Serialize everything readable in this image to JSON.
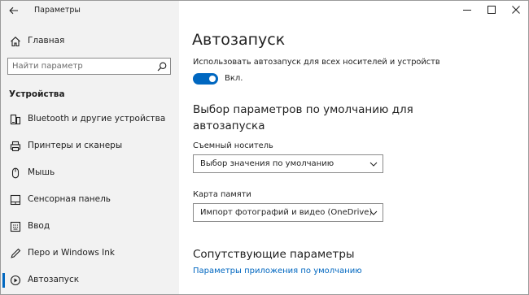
{
  "window": {
    "title": "Параметры",
    "controls": {
      "minimize_icon": "minimize-icon",
      "maximize_icon": "maximize-icon",
      "close_icon": "close-icon"
    }
  },
  "sidebar": {
    "back_icon": "back-arrow-icon",
    "home": {
      "label": "Главная",
      "icon": "home-icon"
    },
    "search": {
      "placeholder": "Найти параметр",
      "value": "",
      "icon": "search-icon"
    },
    "section_title": "Устройства",
    "items": [
      {
        "label": "Bluetooth и другие устройства",
        "icon": "bluetooth-devices-icon",
        "selected": false
      },
      {
        "label": "Принтеры и сканеры",
        "icon": "printer-icon",
        "selected": false
      },
      {
        "label": "Мышь",
        "icon": "mouse-icon",
        "selected": false
      },
      {
        "label": "Сенсорная панель",
        "icon": "touchpad-icon",
        "selected": false
      },
      {
        "label": "Ввод",
        "icon": "keyboard-icon",
        "selected": false
      },
      {
        "label": "Перо и Windows Ink",
        "icon": "pen-icon",
        "selected": false
      },
      {
        "label": "Автозапуск",
        "icon": "autoplay-icon",
        "selected": true
      }
    ]
  },
  "main": {
    "page_title": "Автозапуск",
    "autoplay_setting": {
      "description": "Использовать автозапуск для всех носителей и устройств",
      "toggle_on": true,
      "toggle_label": "Вкл."
    },
    "defaults_heading": "Выбор параметров по умолчанию для автозапуска",
    "removable_drive": {
      "label": "Съемный носитель",
      "selected": "Выбор значения по умолчанию"
    },
    "memory_card": {
      "label": "Карта памяти",
      "selected": "Импорт фотографий и видео (OneDrive)"
    },
    "related_heading": "Сопутствующие параметры",
    "related_link": "Параметры приложения по умолчанию"
  },
  "colors": {
    "accent": "#0067c0",
    "sidebar_bg": "#f2f2f2",
    "text": "#1f1f1f"
  }
}
